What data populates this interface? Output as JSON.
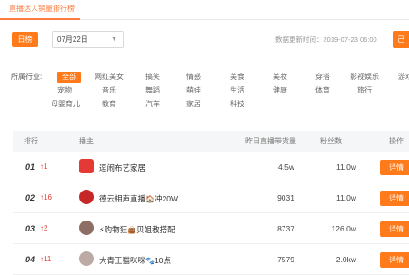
{
  "tab": {
    "label": "直播达人销量排行榜"
  },
  "filters": {
    "date_type": "日榜",
    "date_value": "07月22日",
    "update_time": "数据更新时间：2019-07-23 06:00",
    "export_label": "己"
  },
  "industry": {
    "label": "所属行业:",
    "items": [
      "全部",
      "网红美女",
      "搞笑",
      "情感",
      "美食",
      "美妆",
      "穿搭",
      "影视娱乐",
      "游戏",
      "宠物",
      "音乐",
      "舞蹈",
      "萌娃",
      "生活",
      "健康",
      "体育",
      "旅行",
      "母婴育儿",
      "教育",
      "汽车",
      "家居",
      "科技"
    ],
    "active_index": 0
  },
  "table": {
    "headers": [
      "排行",
      "播主",
      "昨日直播带货量",
      "粉丝数",
      "操作"
    ],
    "rows": [
      {
        "rank": "01",
        "trend": "↑1",
        "name": "逗闹布艺家居",
        "sales": "4.5w",
        "fans": "11.0w",
        "action": "详情",
        "avatar_color": "#e53935"
      },
      {
        "rank": "02",
        "trend": "↑16",
        "name": "德云相声直播",
        "name_suffix": "冲20W",
        "sales": "9031",
        "fans": "11.0w",
        "action": "详情",
        "avatar_color": "#c62828"
      },
      {
        "rank": "03",
        "trend": "↑2",
        "name": "购物狂",
        "name_suffix": "贝姐教搭配",
        "sales": "8737",
        "fans": "126.0w",
        "action": "详情",
        "avatar_color": "#8d6e63"
      },
      {
        "rank": "04",
        "trend": "↑11",
        "name": "大青王猫咪咪",
        "name_suffix": "10点",
        "sales": "7579",
        "fans": "2.0kw",
        "action": "详情",
        "avatar_color": "#bcaaa4"
      }
    ]
  },
  "colors": {
    "accent": "#ff7a1a",
    "trend_up": "#e63c2f"
  }
}
